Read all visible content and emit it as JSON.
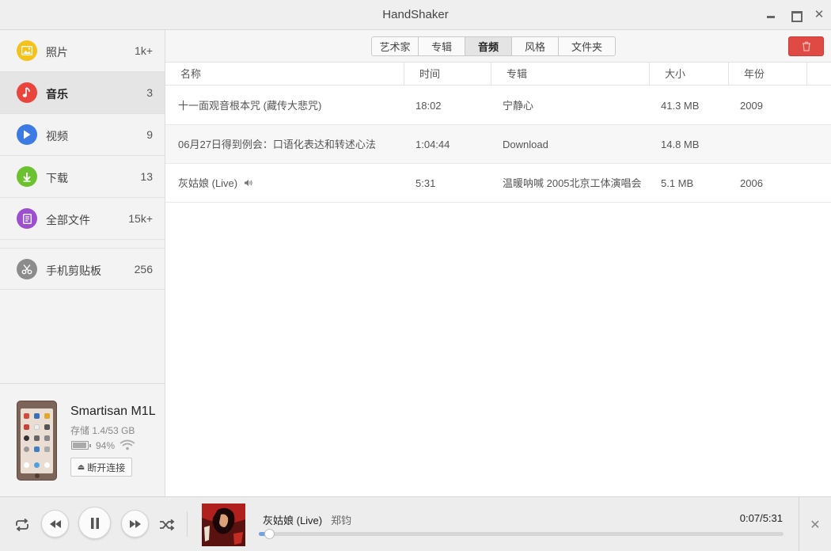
{
  "window": {
    "title": "HandShaker"
  },
  "sidebar": {
    "items": [
      {
        "label": "照片",
        "count": "1k+",
        "icon": "photo-icon",
        "color": "#f5c21b"
      },
      {
        "label": "音乐",
        "count": "3",
        "icon": "music-note-icon",
        "color": "#e9453d",
        "active": true
      },
      {
        "label": "视频",
        "count": "9",
        "icon": "play-icon",
        "color": "#3c7be4"
      },
      {
        "label": "下载",
        "count": "13",
        "icon": "download-arrow-icon",
        "color": "#6cc12e"
      },
      {
        "label": "全部文件",
        "count": "15k+",
        "icon": "document-icon",
        "color": "#9c4fcf"
      },
      {
        "label": "手机剪贴板",
        "count": "256",
        "icon": "scissors-icon",
        "color": "#8c8c8c"
      }
    ]
  },
  "device": {
    "name": "Smartisan M1L",
    "storage": "存储 1.4/53 GB",
    "battery": "94%",
    "battery_level": 0.94,
    "disconnect_label": "断开连接"
  },
  "tabs": [
    {
      "label": "艺术家"
    },
    {
      "label": "专辑"
    },
    {
      "label": "音频",
      "active": true
    },
    {
      "label": "风格"
    },
    {
      "label": "文件夹"
    }
  ],
  "table": {
    "columns": [
      "名称",
      "时间",
      "专辑",
      "大小",
      "年份"
    ],
    "rows": [
      {
        "name": "十一面观音根本咒 (藏传大悲咒)",
        "time": "18:02",
        "album": "宁静心",
        "size": "41.3 MB",
        "year": "2009"
      },
      {
        "name": "06月27日得到例会：口语化表达和转述心法",
        "time": "1:04:44",
        "album": "Download",
        "size": "14.8 MB",
        "year": ""
      },
      {
        "name": "灰姑娘 (Live)",
        "time": "5:31",
        "album": "温暖呐喊 2005北京工体演唱会",
        "size": "5.1 MB",
        "year": "2006",
        "playing": true
      }
    ]
  },
  "player": {
    "title": "灰姑娘 (Live)",
    "artist": "郑钧",
    "time": "0:07/5:31",
    "progress": 0.02,
    "controls": [
      "repeat-icon",
      "rewind-icon",
      "pause-icon",
      "fast-forward-icon",
      "shuffle-icon",
      "close-icon"
    ]
  },
  "colors": {
    "accent_blue": "#6fa4e0",
    "delete_red": "#e04a45"
  }
}
